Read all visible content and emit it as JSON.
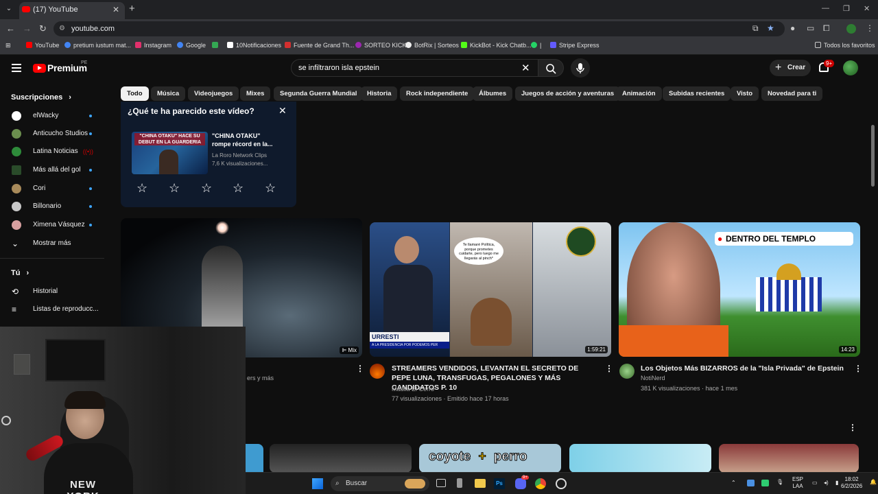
{
  "browser": {
    "tab_title": "(17) YouTube",
    "url": "youtube.com",
    "bookmarks": [
      {
        "label": "YouTube",
        "color": "#ff0000"
      },
      {
        "label": "pretium iustum mat...",
        "color": "#4285f4"
      },
      {
        "label": "Instagram",
        "color": "#e1306c"
      },
      {
        "label": "Google",
        "color": "#4285f4"
      },
      {
        "label": "",
        "color": "#34a853"
      },
      {
        "label": "10Notificaciones",
        "color": "#ffffff"
      },
      {
        "label": "Fuente de Grand Th...",
        "color": "#d32f2f"
      },
      {
        "label": "SORTEO KICK",
        "color": "#9c27b0"
      },
      {
        "label": "BotRix | Sorteos",
        "color": "#eeeeee"
      },
      {
        "label": "KickBot - Kick Chatb...",
        "color": "#53fc18"
      },
      {
        "label": "|",
        "color": "#25d366"
      },
      {
        "label": "Stripe Express",
        "color": "#635bff"
      }
    ],
    "all_favorites": "Todos los favoritos"
  },
  "header": {
    "logo_text": "Premium",
    "country": "PE",
    "search_query": "se infiltraron isla epstein",
    "create_label": "Crear",
    "notif_count": "9+"
  },
  "sidebar": {
    "subs_title": "Suscripciones",
    "subscriptions": [
      {
        "name": "elWacky",
        "color": "#ffffff"
      },
      {
        "name": "Anticucho Studios",
        "color": "#6b8e4e"
      },
      {
        "name": "Latina Noticias",
        "color": "#2e8b3a"
      },
      {
        "name": "Más allá del gol",
        "color": "#2a4b2a"
      },
      {
        "name": "Cori",
        "color": "#a88a5a"
      },
      {
        "name": "Billonario",
        "color": "#c8c8c8"
      },
      {
        "name": "Ximena Vásquez",
        "color": "#d8a0a0"
      }
    ],
    "show_more": "Mostrar más",
    "you_title": "Tú",
    "you_items": [
      "Historial",
      "Listas de reproducc..."
    ]
  },
  "chips": [
    "Todo",
    "Música",
    "Videojuegos",
    "Mixes",
    "Segunda Guerra Mundial",
    "Historia",
    "Rock independiente",
    "Álbumes",
    "Juegos de acción y aventuras",
    "Animación",
    "Subidas recientes",
    "Visto",
    "Novedad para ti"
  ],
  "survey": {
    "question": "¿Qué te ha parecido este vídeo?",
    "thumb_text": "\"CHINA OTAKU\" HACE SU DEBUT EN LA GUARDERIA",
    "video_title": "\"CHINA OTAKU\" rompe récord en la...",
    "channel": "La Roro Network Clips",
    "views": "7,6 K visualizaciones..."
  },
  "videos": [
    {
      "badge": "Mix",
      "meta_partial": "ers y más"
    },
    {
      "title": "STREAMERS VENDIDOS, LEVANTAN EL SECRETO DE PEPE LUNA, TRANSFUGAS, PEGALONES Y MÁS CANDIDATOS P. 10",
      "channel": "Maúlla El Cerro",
      "meta": "77 visualizaciones · Emitido hace 17 horas",
      "duration": "1:59:21",
      "bubble_text": "Te llamaré Política, porque prometes cuidarte, pero luego me llegarás al pinch*",
      "ticker": "URRESTI",
      "ticker_sub": "A LA PRESIDENCIA POR PODEMOS PER"
    },
    {
      "title": "Los Objetos Más BIZARROS de la \"Isla Privada\" de Epstein",
      "channel": "NotiNerd",
      "meta": "381 K visualizaciones · hace 1 mes",
      "duration": "14:23",
      "overlay": "DENTRO DEL TEMPLO"
    }
  ],
  "bottom_row": {
    "thumb_text_a": "coyote",
    "thumb_text_b": "+",
    "thumb_text_c": "perro"
  },
  "webcam": {
    "shirt_text": "NEW YORK"
  },
  "taskbar": {
    "search": "Buscar",
    "lang": "ESP",
    "lang2": "LAA",
    "time": "18:02",
    "date": "6/2/2026",
    "discord_badge": "9+",
    "ps_label": "Ps"
  }
}
